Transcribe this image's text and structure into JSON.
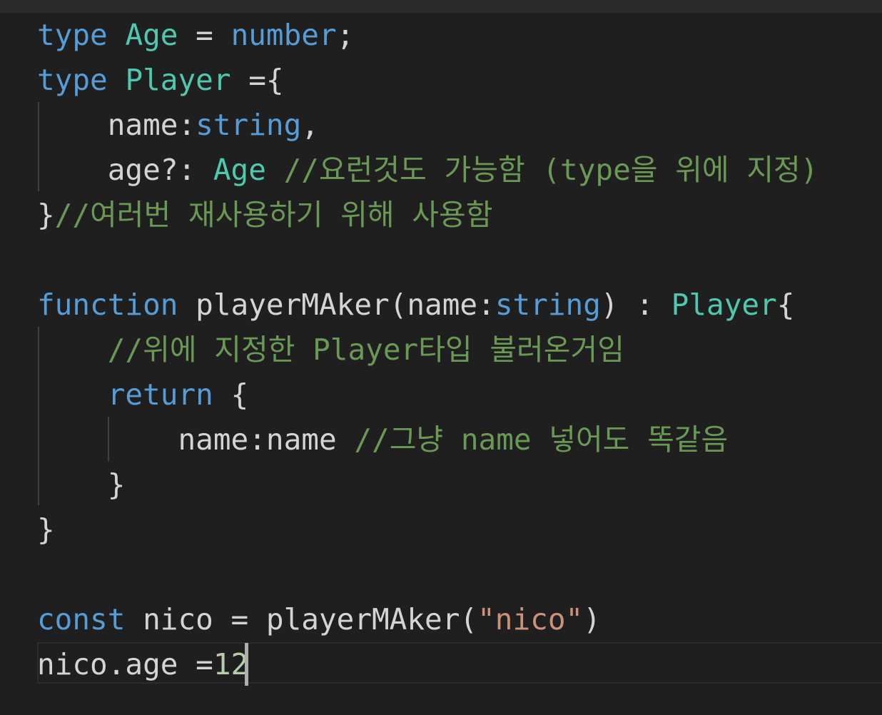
{
  "editor": {
    "lines": [
      {
        "t1": "type",
        "t2": " ",
        "t3": "Age",
        "t4": " = ",
        "t5": "number",
        "t6": ";"
      },
      {
        "t1": "type",
        "t2": " ",
        "t3": "Player",
        "t4": " ={"
      },
      {
        "t1": "    name:",
        "t2": "string",
        "t3": ","
      },
      {
        "t1": "    age?: ",
        "t2": "Age",
        "t3": " ",
        "t4": "//요런것도 가능함 (type을 위에 지정)"
      },
      {
        "t1": "}",
        "t2": "//여러번 재사용하기 위해 사용함"
      },
      {},
      {
        "t1": "function",
        "t2": " playerMAker(name:",
        "t3": "string",
        "t4": ") : ",
        "t5": "Player",
        "t6": "{"
      },
      {
        "t1": "    ",
        "t2": "//위에 지정한 Player타입 불러온거임"
      },
      {
        "t1": "    ",
        "t2": "return",
        "t3": " {"
      },
      {
        "t1": "        name:name ",
        "t2": "//그냥 name 넣어도 똑같음"
      },
      {
        "t1": "    }"
      },
      {
        "t1": "}"
      },
      {},
      {
        "t1": "const",
        "t2": " nico = playerMAker(",
        "t3": "\"nico\"",
        "t4": ")"
      },
      {
        "t1": "nico.age =",
        "t2": "12"
      }
    ]
  },
  "colors": {
    "keyword": "#569cd6",
    "type": "#4ec9b0",
    "comment": "#6a9955",
    "string": "#ce9178",
    "number": "#b5cea8",
    "text": "#d4d4d4",
    "background": "#1f1f1f"
  }
}
